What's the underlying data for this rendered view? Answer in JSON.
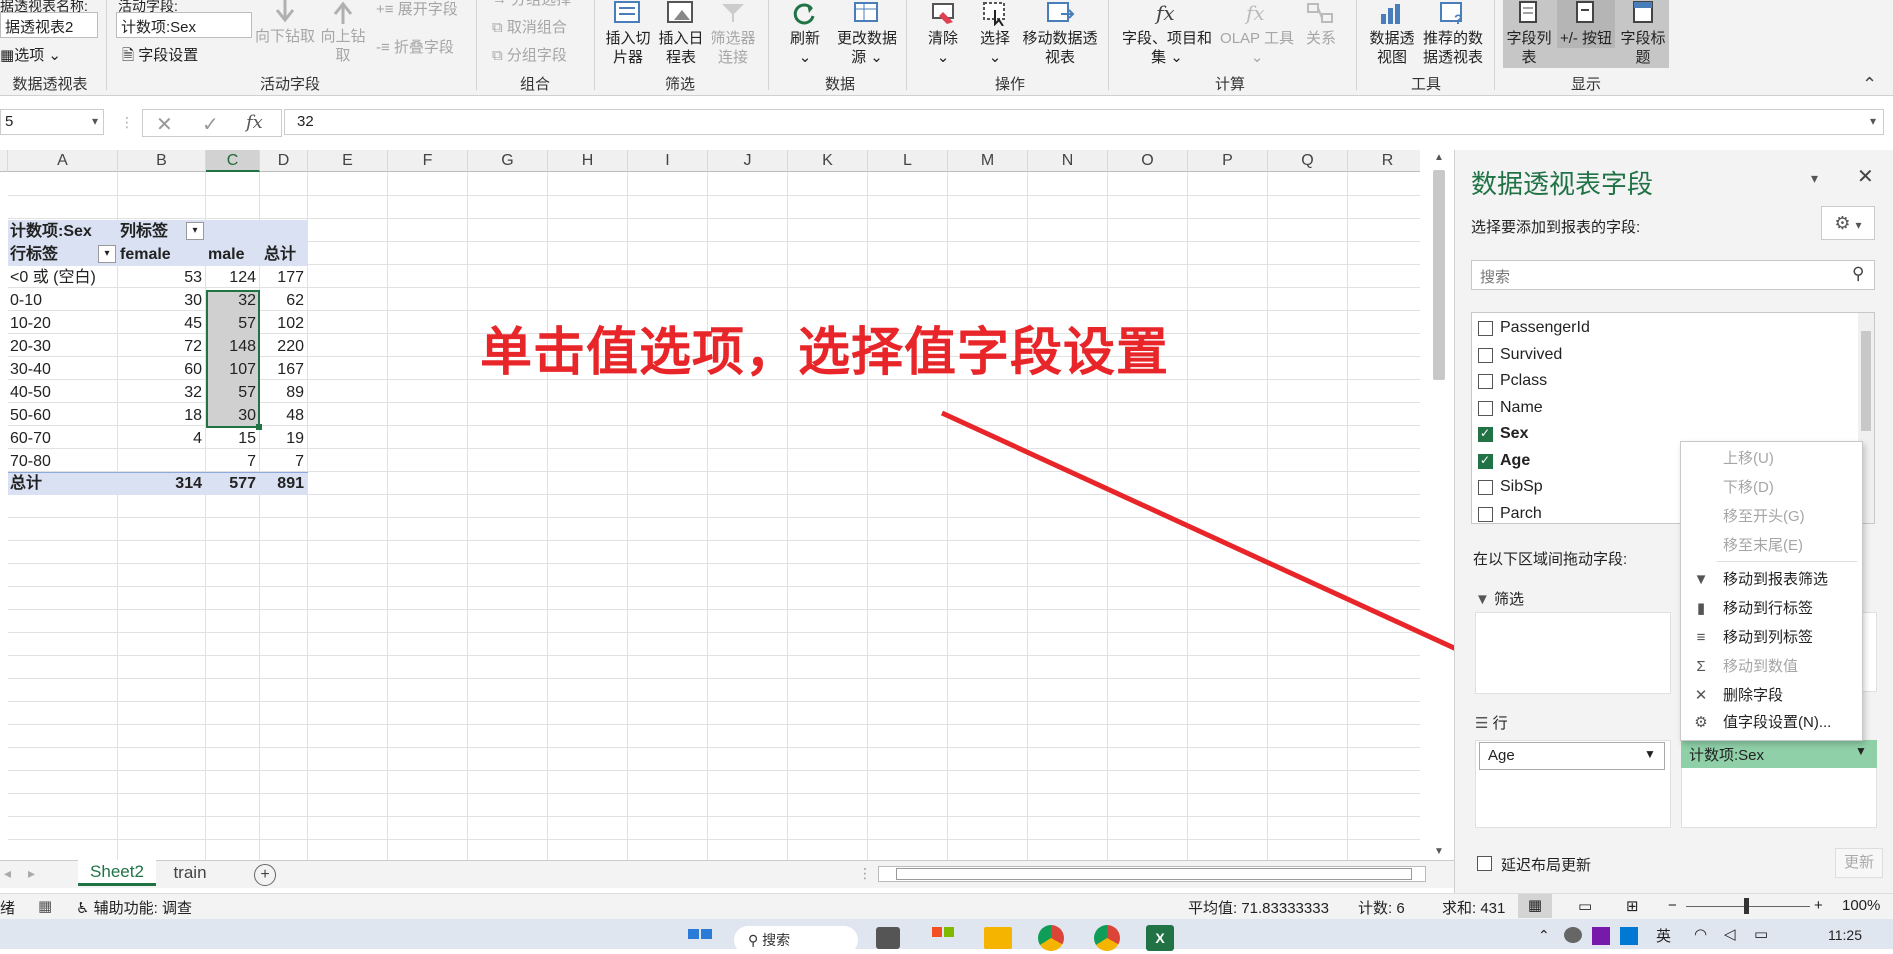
{
  "ribbon": {
    "name_label": "据透视表名称:",
    "name_value": "据透视表2",
    "options_label": "选项",
    "group_pivot": "数据透视表",
    "active_field_label": "活动字段:",
    "active_field_value": "计数项:Sex",
    "field_settings": "字段设置",
    "drill_down": "向下钻取",
    "drill_up": "向上钻取",
    "expand_field": "展开字段",
    "collapse_field": "折叠字段",
    "group_active": "活动字段",
    "group_selection": "分组选择",
    "ungroup": "取消组合",
    "group_field": "分组字段",
    "group_group": "组合",
    "insert_slicer": "插入切片器",
    "insert_timeline": "插入日程表",
    "filter_conn": "筛选器连接",
    "group_filter": "筛选",
    "refresh": "刷新",
    "change_source": "更改数据源",
    "group_data": "数据",
    "clear": "清除",
    "select": "选择",
    "move_pivot": "移动数据透视表",
    "group_actions": "操作",
    "fields_items": "字段、项目和集",
    "olap_tools": "OLAP 工具",
    "relations": "关系",
    "group_calc": "计算",
    "pivot_chart": "数据透视图",
    "recommended": "推荐的数据透视表",
    "group_tools": "工具",
    "field_list": "字段列表",
    "pm_buttons": "+/- 按钮",
    "field_headers": "字段标题",
    "group_show": "显示"
  },
  "formula_bar": {
    "name_box": "5",
    "fx": "fx",
    "value": "32"
  },
  "columns": [
    "A",
    "B",
    "C",
    "D",
    "E",
    "F",
    "G",
    "H",
    "I",
    "J",
    "K",
    "L",
    "M",
    "N",
    "O",
    "P",
    "Q",
    "R"
  ],
  "pivot": {
    "count_label": "计数项:Sex",
    "col_label": "列标签",
    "row_label": "行标签",
    "female": "female",
    "male": "male",
    "total": "总计",
    "rows": [
      {
        "label": "<0 或 (空白)",
        "female": "53",
        "male": "124",
        "total": "177"
      },
      {
        "label": "0-10",
        "female": "30",
        "male": "32",
        "total": "62"
      },
      {
        "label": "10-20",
        "female": "45",
        "male": "57",
        "total": "102"
      },
      {
        "label": "20-30",
        "female": "72",
        "male": "148",
        "total": "220"
      },
      {
        "label": "30-40",
        "female": "60",
        "male": "107",
        "total": "167"
      },
      {
        "label": "40-50",
        "female": "32",
        "male": "57",
        "total": "89"
      },
      {
        "label": "50-60",
        "female": "18",
        "male": "30",
        "total": "48"
      },
      {
        "label": "60-70",
        "female": "4",
        "male": "15",
        "total": "19"
      },
      {
        "label": "70-80",
        "female": "",
        "male": "7",
        "total": "7"
      }
    ],
    "grand": {
      "label": "总计",
      "female": "314",
      "male": "577",
      "total": "891"
    }
  },
  "annotation": "单击值选项，选择值字段设置",
  "pane": {
    "title": "数据透视表字段",
    "subtitle": "选择要添加到报表的字段:",
    "search_placeholder": "搜索",
    "fields": [
      {
        "name": "PassengerId",
        "checked": false
      },
      {
        "name": "Survived",
        "checked": false
      },
      {
        "name": "Pclass",
        "checked": false
      },
      {
        "name": "Name",
        "checked": false
      },
      {
        "name": "Sex",
        "checked": true
      },
      {
        "name": "Age",
        "checked": true
      },
      {
        "name": "SibSp",
        "checked": false
      },
      {
        "name": "Parch",
        "checked": false
      }
    ],
    "drag_label": "在以下区域间拖动字段:",
    "filter_area": "筛选",
    "rows_area": "行",
    "row_field": "Age",
    "value_field": "计数项:Sex",
    "defer_label": "延迟布局更新",
    "update_btn": "更新"
  },
  "context_menu": {
    "items": [
      {
        "label": "上移(U)",
        "disabled": true,
        "icon": ""
      },
      {
        "label": "下移(D)",
        "disabled": true,
        "icon": ""
      },
      {
        "label": "移至开头(G)",
        "disabled": true,
        "icon": ""
      },
      {
        "label": "移至末尾(E)",
        "disabled": true,
        "icon": ""
      },
      {
        "label": "移动到报表筛选",
        "disabled": false,
        "icon": "filter-icon"
      },
      {
        "label": "移动到行标签",
        "disabled": false,
        "icon": "rows-icon"
      },
      {
        "label": "移动到列标签",
        "disabled": false,
        "icon": "columns-icon"
      },
      {
        "label": "移动到数值",
        "disabled": true,
        "icon": "sigma-icon"
      },
      {
        "label": "删除字段",
        "disabled": false,
        "icon": "close-icon"
      },
      {
        "label": "值字段设置(N)...",
        "disabled": false,
        "icon": "value-settings-icon"
      }
    ]
  },
  "sheets": [
    "Sheet2",
    "train"
  ],
  "status": {
    "ready": "绪",
    "accessibility": "辅助功能: 调查",
    "average": "平均值: 71.83333333",
    "count": "计数: 6",
    "sum": "求和: 431",
    "zoom": "100%"
  },
  "taskbar": {
    "search": "搜索",
    "lang": "英",
    "time": "11:25"
  },
  "colors": {
    "accent": "#217346",
    "annotation": "#e8262a",
    "header_fill": "#d9e1f2"
  }
}
